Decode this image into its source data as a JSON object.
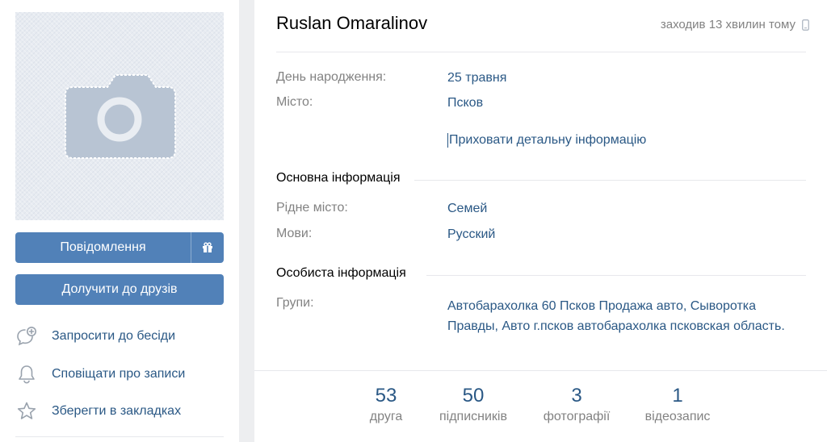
{
  "profile": {
    "name": "Ruslan Omaralinov",
    "last_seen": "заходив 13 хвилин тому",
    "status_device_icon": "phone-icon"
  },
  "actions": {
    "message_label": "Повідомлення",
    "gift_icon": "gift-icon",
    "add_friend_label": "Долучити до друзів",
    "invite_label": "Запросити до бесіди",
    "notify_label": "Сповіщати про записи",
    "bookmark_label": "Зберегти в закладках"
  },
  "info": {
    "birthday_label": "День народження:",
    "birthday_value": "25 травня",
    "city_label": "Місто:",
    "city_value": "Псков",
    "toggle_details": "Приховати детальну інформацію",
    "main_section_title": "Основна інформація",
    "hometown_label": "Рідне місто:",
    "hometown_value": "Семей",
    "languages_label": "Мови:",
    "languages_value": "Русский",
    "personal_section_title": "Особиста інформація",
    "groups_label": "Групи:",
    "groups_value": "Автобарахолка 60 Псков Продажа авто, Сыворотка Правды, Авто г.псков автобарахолка псковская область."
  },
  "counters": [
    {
      "count": "53",
      "label": "друга"
    },
    {
      "count": "50",
      "label": "підписників"
    },
    {
      "count": "3",
      "label": "фотографії"
    },
    {
      "count": "1",
      "label": "відеозапис"
    }
  ],
  "colors": {
    "accent": "#5181b8",
    "link": "#2a5885",
    "muted": "#828282",
    "background": "#edeef0"
  }
}
